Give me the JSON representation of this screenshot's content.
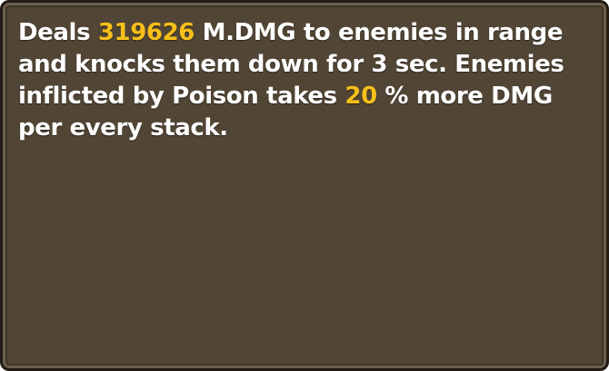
{
  "skill": {
    "desc_part1": "Deals ",
    "damage_value": "319626",
    "desc_part2": " M.DMG to enemies in range and knocks them down for 3 sec. Enemies inflicted by Poison takes ",
    "poison_bonus_value": "20",
    "desc_part3": " % more DMG per every stack."
  },
  "colors": {
    "background": "#514535",
    "border": "#231c14",
    "text": "#ffffff",
    "highlight": "#f7bf1a"
  }
}
